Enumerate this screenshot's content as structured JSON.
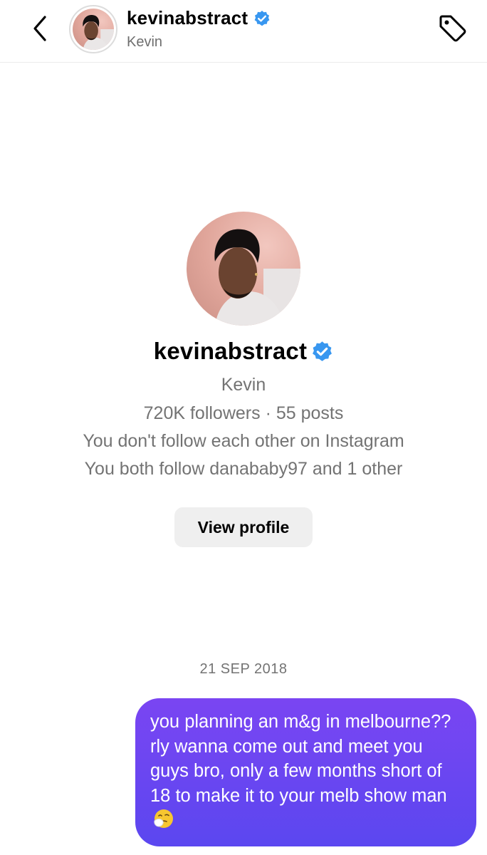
{
  "header": {
    "username": "kevinabstract",
    "name": "Kevin",
    "verified": true,
    "back_icon": "chevron-left-icon",
    "tag_icon": "tag-icon"
  },
  "profile": {
    "username": "kevinabstract",
    "name": "Kevin",
    "stats": "720K followers · 55 posts",
    "follow_status": "You don't follow each other on Instagram",
    "mutual": "You both follow danababy97 and 1 other",
    "view_profile_label": "View profile"
  },
  "thread": {
    "date": "21 SEP 2018",
    "messages": [
      {
        "from": "me",
        "text": "you planning an m&g in melbourne?? rly wanna come out and meet you guys bro, only a few months short of 18 to make it to your melb show man",
        "emoji": "sneezing-face-icon"
      }
    ]
  },
  "colors": {
    "verified_blue": "#3897f0",
    "bubble_top": "#7a45f2",
    "bubble_bottom": "#5b47f0",
    "secondary_text": "#737373",
    "button_bg": "#efefef"
  }
}
